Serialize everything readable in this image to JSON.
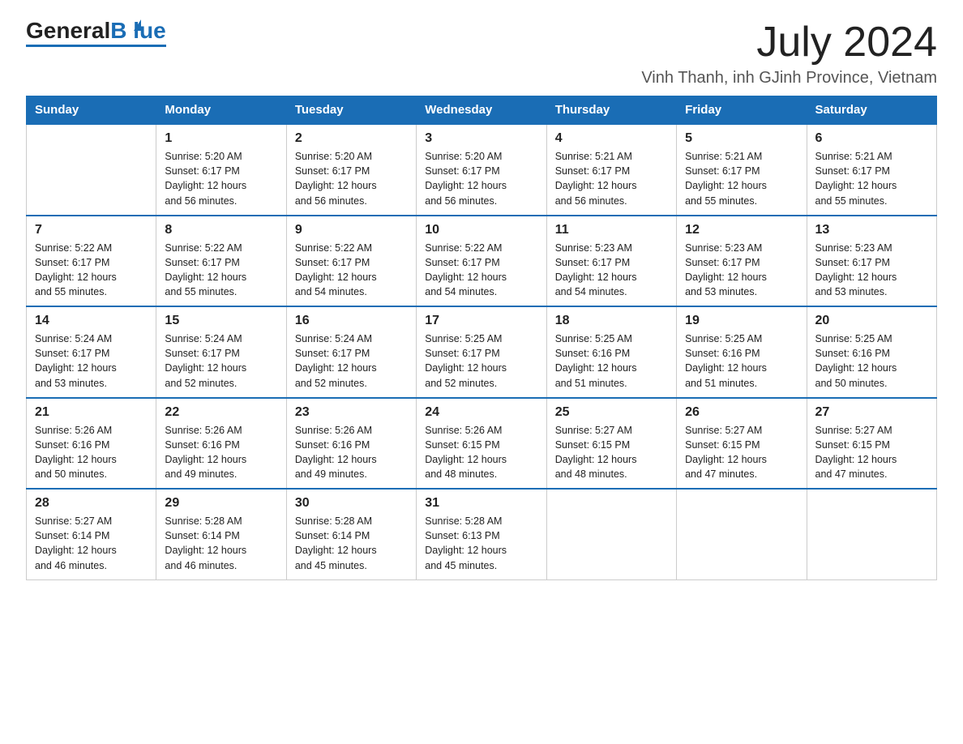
{
  "header": {
    "logo_general": "General",
    "logo_blue": "Blue",
    "month_title": "July 2024",
    "location": "Vinh Thanh, inh GJinh Province, Vietnam"
  },
  "weekdays": [
    "Sunday",
    "Monday",
    "Tuesday",
    "Wednesday",
    "Thursday",
    "Friday",
    "Saturday"
  ],
  "weeks": [
    [
      {
        "day": "",
        "info": ""
      },
      {
        "day": "1",
        "info": "Sunrise: 5:20 AM\nSunset: 6:17 PM\nDaylight: 12 hours\nand 56 minutes."
      },
      {
        "day": "2",
        "info": "Sunrise: 5:20 AM\nSunset: 6:17 PM\nDaylight: 12 hours\nand 56 minutes."
      },
      {
        "day": "3",
        "info": "Sunrise: 5:20 AM\nSunset: 6:17 PM\nDaylight: 12 hours\nand 56 minutes."
      },
      {
        "day": "4",
        "info": "Sunrise: 5:21 AM\nSunset: 6:17 PM\nDaylight: 12 hours\nand 56 minutes."
      },
      {
        "day": "5",
        "info": "Sunrise: 5:21 AM\nSunset: 6:17 PM\nDaylight: 12 hours\nand 55 minutes."
      },
      {
        "day": "6",
        "info": "Sunrise: 5:21 AM\nSunset: 6:17 PM\nDaylight: 12 hours\nand 55 minutes."
      }
    ],
    [
      {
        "day": "7",
        "info": "Sunrise: 5:22 AM\nSunset: 6:17 PM\nDaylight: 12 hours\nand 55 minutes."
      },
      {
        "day": "8",
        "info": "Sunrise: 5:22 AM\nSunset: 6:17 PM\nDaylight: 12 hours\nand 55 minutes."
      },
      {
        "day": "9",
        "info": "Sunrise: 5:22 AM\nSunset: 6:17 PM\nDaylight: 12 hours\nand 54 minutes."
      },
      {
        "day": "10",
        "info": "Sunrise: 5:22 AM\nSunset: 6:17 PM\nDaylight: 12 hours\nand 54 minutes."
      },
      {
        "day": "11",
        "info": "Sunrise: 5:23 AM\nSunset: 6:17 PM\nDaylight: 12 hours\nand 54 minutes."
      },
      {
        "day": "12",
        "info": "Sunrise: 5:23 AM\nSunset: 6:17 PM\nDaylight: 12 hours\nand 53 minutes."
      },
      {
        "day": "13",
        "info": "Sunrise: 5:23 AM\nSunset: 6:17 PM\nDaylight: 12 hours\nand 53 minutes."
      }
    ],
    [
      {
        "day": "14",
        "info": "Sunrise: 5:24 AM\nSunset: 6:17 PM\nDaylight: 12 hours\nand 53 minutes."
      },
      {
        "day": "15",
        "info": "Sunrise: 5:24 AM\nSunset: 6:17 PM\nDaylight: 12 hours\nand 52 minutes."
      },
      {
        "day": "16",
        "info": "Sunrise: 5:24 AM\nSunset: 6:17 PM\nDaylight: 12 hours\nand 52 minutes."
      },
      {
        "day": "17",
        "info": "Sunrise: 5:25 AM\nSunset: 6:17 PM\nDaylight: 12 hours\nand 52 minutes."
      },
      {
        "day": "18",
        "info": "Sunrise: 5:25 AM\nSunset: 6:16 PM\nDaylight: 12 hours\nand 51 minutes."
      },
      {
        "day": "19",
        "info": "Sunrise: 5:25 AM\nSunset: 6:16 PM\nDaylight: 12 hours\nand 51 minutes."
      },
      {
        "day": "20",
        "info": "Sunrise: 5:25 AM\nSunset: 6:16 PM\nDaylight: 12 hours\nand 50 minutes."
      }
    ],
    [
      {
        "day": "21",
        "info": "Sunrise: 5:26 AM\nSunset: 6:16 PM\nDaylight: 12 hours\nand 50 minutes."
      },
      {
        "day": "22",
        "info": "Sunrise: 5:26 AM\nSunset: 6:16 PM\nDaylight: 12 hours\nand 49 minutes."
      },
      {
        "day": "23",
        "info": "Sunrise: 5:26 AM\nSunset: 6:16 PM\nDaylight: 12 hours\nand 49 minutes."
      },
      {
        "day": "24",
        "info": "Sunrise: 5:26 AM\nSunset: 6:15 PM\nDaylight: 12 hours\nand 48 minutes."
      },
      {
        "day": "25",
        "info": "Sunrise: 5:27 AM\nSunset: 6:15 PM\nDaylight: 12 hours\nand 48 minutes."
      },
      {
        "day": "26",
        "info": "Sunrise: 5:27 AM\nSunset: 6:15 PM\nDaylight: 12 hours\nand 47 minutes."
      },
      {
        "day": "27",
        "info": "Sunrise: 5:27 AM\nSunset: 6:15 PM\nDaylight: 12 hours\nand 47 minutes."
      }
    ],
    [
      {
        "day": "28",
        "info": "Sunrise: 5:27 AM\nSunset: 6:14 PM\nDaylight: 12 hours\nand 46 minutes."
      },
      {
        "day": "29",
        "info": "Sunrise: 5:28 AM\nSunset: 6:14 PM\nDaylight: 12 hours\nand 46 minutes."
      },
      {
        "day": "30",
        "info": "Sunrise: 5:28 AM\nSunset: 6:14 PM\nDaylight: 12 hours\nand 45 minutes."
      },
      {
        "day": "31",
        "info": "Sunrise: 5:28 AM\nSunset: 6:13 PM\nDaylight: 12 hours\nand 45 minutes."
      },
      {
        "day": "",
        "info": ""
      },
      {
        "day": "",
        "info": ""
      },
      {
        "day": "",
        "info": ""
      }
    ]
  ]
}
